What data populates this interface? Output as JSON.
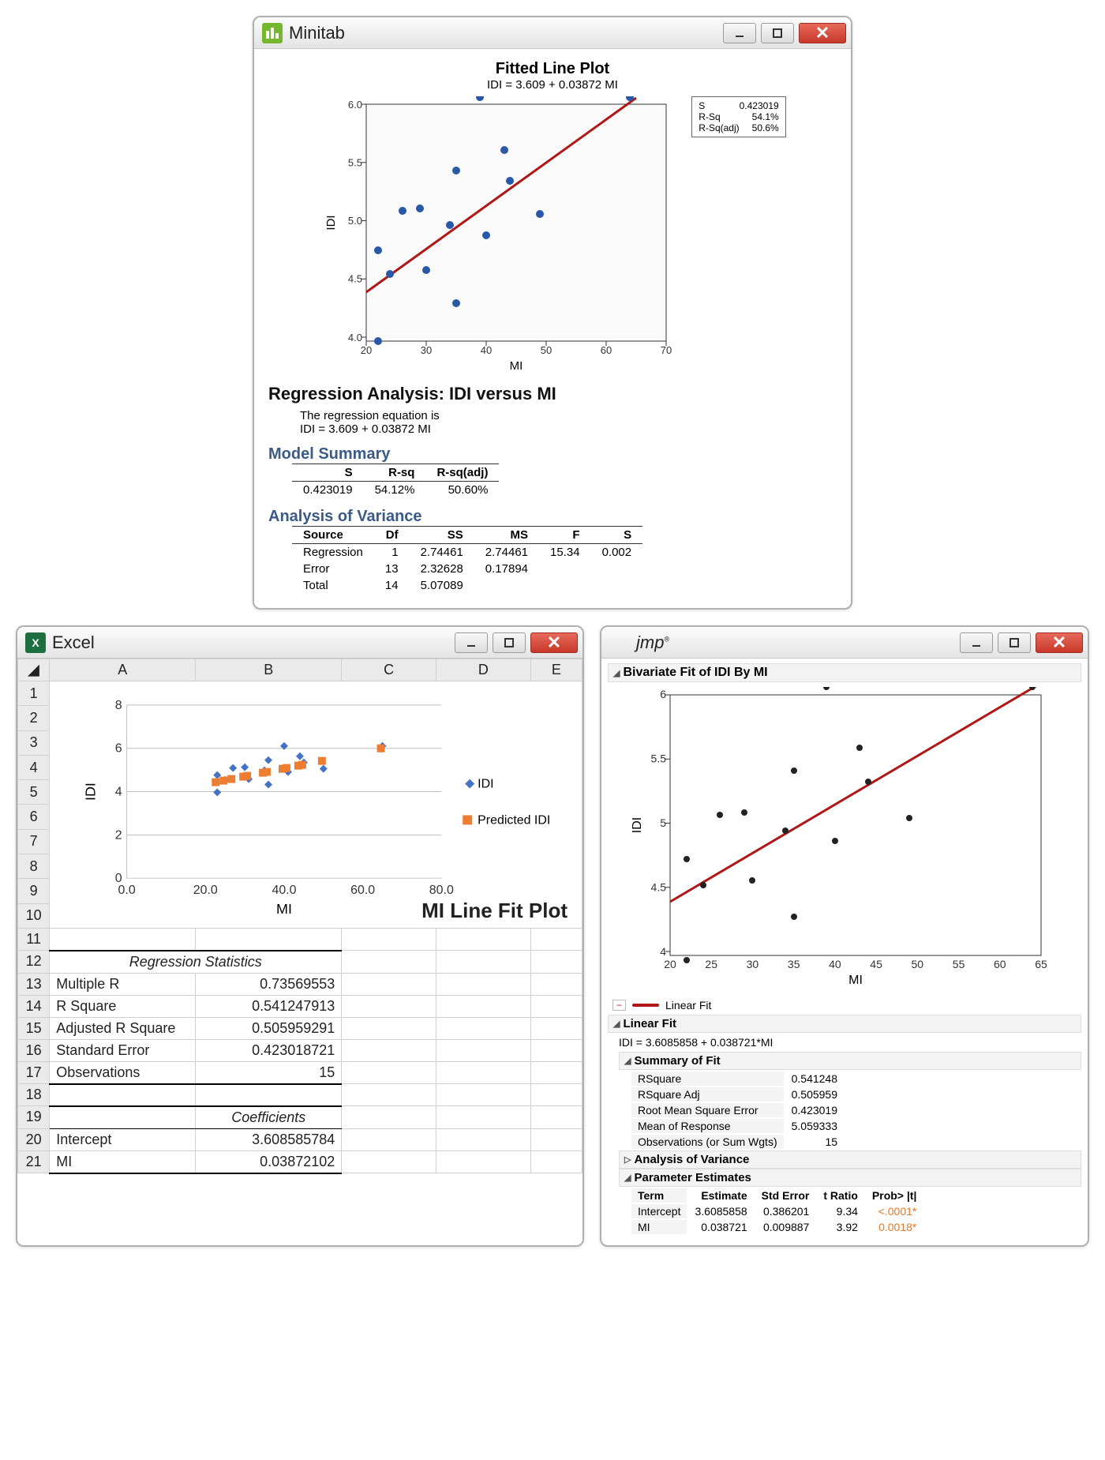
{
  "minitab": {
    "app_name": "Minitab",
    "chart": {
      "title": "Fitted Line Plot",
      "subtitle": "IDI = 3.609 + 0.03872 MI",
      "xlabel": "MI",
      "ylabel": "IDI",
      "legend": {
        "s_label": "S",
        "s_val": "0.423019",
        "rsq_label": "R-Sq",
        "rsq_val": "54.1%",
        "rsqa_label": "R-Sq(adj)",
        "rsqa_val": "50.6%"
      }
    },
    "reg_heading": "Regression Analysis: IDI versus MI",
    "eq_intro": "The regression equation is",
    "eq": "IDI = 3.609 + 0.03872 MI",
    "model_summary_hdr": "Model Summary",
    "model_summary": {
      "s_hdr": "S",
      "rsq_hdr": "R-sq",
      "rsqa_hdr": "R-sq(adj)",
      "s": "0.423019",
      "rsq": "54.12%",
      "rsqa": "50.60%"
    },
    "anova_hdr": "Analysis of Variance",
    "anova": {
      "h_source": "Source",
      "h_df": "Df",
      "h_ss": "SS",
      "h_ms": "MS",
      "h_f": "F",
      "h_s": "S",
      "r1": {
        "source": "Regression",
        "df": "1",
        "ss": "2.74461",
        "ms": "2.74461",
        "f": "15.34",
        "s": "0.002"
      },
      "r2": {
        "source": "Error",
        "df": "13",
        "ss": "2.32628",
        "ms": "0.17894",
        "f": "",
        "s": ""
      },
      "r3": {
        "source": "Total",
        "df": "14",
        "ss": "5.07089",
        "ms": "",
        "f": "",
        "s": ""
      }
    }
  },
  "excel": {
    "app_name": "Excel",
    "cols": {
      "A": "A",
      "B": "B",
      "C": "C",
      "D": "D",
      "E": "E"
    },
    "rows": [
      "1",
      "2",
      "3",
      "4",
      "5",
      "6",
      "7",
      "8",
      "9",
      "10",
      "11",
      "12",
      "13",
      "14",
      "15",
      "16",
      "17",
      "18",
      "19",
      "20",
      "21"
    ],
    "chart": {
      "title": "MI Line Fit Plot",
      "xlabel": "MI",
      "ylabel": "IDI",
      "legend1": "IDI",
      "legend2": "Predicted IDI"
    },
    "reg_stats_hdr": "Regression Statistics",
    "rows_stats": {
      "mr_l": "Multiple R",
      "mr_v": "0.73569553",
      "rsq_l": "R Square",
      "rsq_v": "0.541247913",
      "arsq_l": "Adjusted R Square",
      "arsq_v": "0.505959291",
      "se_l": "Standard Error",
      "se_v": "0.423018721",
      "obs_l": "Observations",
      "obs_v": "15"
    },
    "coef_hdr": "Coefficients",
    "coef": {
      "int_l": "Intercept",
      "int_v": "3.608585784",
      "mi_l": "MI",
      "mi_v": "0.03872102"
    }
  },
  "jmp": {
    "app_name": "jmp",
    "biv_hdr": "Bivariate Fit of IDI By MI",
    "chart": {
      "xlabel": "MI",
      "ylabel": "IDI"
    },
    "linfit_legend": "Linear Fit",
    "linfit_hdr": "Linear Fit",
    "equation": "IDI = 3.6085858 + 0.038721*MI",
    "summary_hdr": "Summary of Fit",
    "summary": {
      "rsq_l": "RSquare",
      "rsq_v": "0.541248",
      "rsqa_l": "RSquare Adj",
      "rsqa_v": "0.505959",
      "rmse_l": "Root Mean Square Error",
      "rmse_v": "0.423019",
      "mean_l": "Mean of Response",
      "mean_v": "5.059333",
      "obs_l": "Observations (or Sum Wgts)",
      "obs_v": "15"
    },
    "anova_hdr": "Analysis of Variance",
    "param_hdr": "Parameter Estimates",
    "param": {
      "h_term": "Term",
      "h_est": "Estimate",
      "h_se": "Std Error",
      "h_t": "t Ratio",
      "h_p": "Prob> |t|",
      "r1": {
        "term": "Intercept",
        "est": "3.6085858",
        "se": "0.386201",
        "t": "9.34",
        "p": "<.0001*"
      },
      "r2": {
        "term": "MI",
        "est": "0.038721",
        "se": "0.009887",
        "t": "3.92",
        "p": "0.0018*"
      }
    }
  },
  "chart_data": [
    {
      "app": "Minitab",
      "type": "scatter",
      "title": "Fitted Line Plot",
      "xlabel": "MI",
      "ylabel": "IDI",
      "xlim": [
        20,
        70
      ],
      "ylim": [
        4.0,
        6.0
      ],
      "points_x": [
        22,
        22,
        24,
        26,
        29,
        30,
        34,
        35,
        35,
        39,
        40,
        43,
        44,
        49,
        64
      ],
      "points_y": [
        3.96,
        4.74,
        4.54,
        5.08,
        5.1,
        4.57,
        4.96,
        5.42,
        4.3,
        6.08,
        4.88,
        5.6,
        5.34,
        5.06,
        6.08
      ],
      "fit": {
        "intercept": 3.609,
        "slope": 0.03872
      }
    },
    {
      "app": "Excel",
      "type": "scatter",
      "title": "MI Line Fit Plot",
      "xlabel": "MI",
      "ylabel": "IDI",
      "xlim": [
        0,
        80
      ],
      "ylim": [
        0,
        8
      ],
      "series": [
        {
          "name": "IDI",
          "x": [
            22,
            22,
            24,
            26,
            29,
            30,
            34,
            35,
            35,
            39,
            40,
            43,
            44,
            49,
            64
          ],
          "y": [
            3.96,
            4.74,
            4.54,
            5.08,
            5.1,
            4.57,
            4.96,
            5.42,
            4.3,
            6.08,
            4.88,
            5.6,
            5.34,
            5.06,
            6.08
          ]
        },
        {
          "name": "Predicted IDI",
          "x": [
            22,
            22,
            24,
            26,
            29,
            30,
            34,
            35,
            35,
            39,
            40,
            43,
            44,
            49,
            64
          ],
          "y": [
            4.46,
            4.46,
            4.54,
            4.62,
            4.73,
            4.77,
            4.93,
            4.96,
            4.96,
            5.12,
            5.16,
            5.27,
            5.31,
            5.51,
            6.09
          ]
        }
      ]
    },
    {
      "app": "JMP",
      "type": "scatter",
      "title": "Bivariate Fit of IDI By MI",
      "xlabel": "MI",
      "ylabel": "IDI",
      "xlim": [
        20,
        65
      ],
      "ylim": [
        4.0,
        6.0
      ],
      "points_x": [
        22,
        22,
        24,
        26,
        29,
        30,
        34,
        35,
        35,
        39,
        40,
        43,
        44,
        49,
        64
      ],
      "points_y": [
        3.96,
        4.74,
        4.54,
        5.08,
        5.1,
        4.57,
        4.96,
        5.42,
        4.3,
        6.08,
        4.88,
        5.6,
        5.34,
        5.06,
        6.08
      ],
      "fit": {
        "intercept": 3.6085858,
        "slope": 0.038721
      }
    }
  ]
}
